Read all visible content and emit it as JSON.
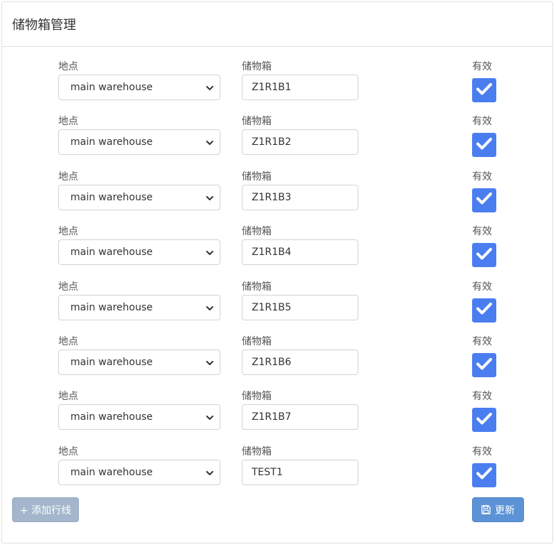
{
  "header": {
    "title": "储物箱管理"
  },
  "labels": {
    "location": "地点",
    "bin": "储物箱",
    "active": "有效"
  },
  "rows": [
    {
      "location": "main warehouse",
      "bin": "Z1R1B1",
      "active": true
    },
    {
      "location": "main warehouse",
      "bin": "Z1R1B2",
      "active": true
    },
    {
      "location": "main warehouse",
      "bin": "Z1R1B3",
      "active": true
    },
    {
      "location": "main warehouse",
      "bin": "Z1R1B4",
      "active": true
    },
    {
      "location": "main warehouse",
      "bin": "Z1R1B5",
      "active": true
    },
    {
      "location": "main warehouse",
      "bin": "Z1R1B6",
      "active": true
    },
    {
      "location": "main warehouse",
      "bin": "Z1R1B7",
      "active": true
    },
    {
      "location": "main warehouse",
      "bin": "TEST1",
      "active": true
    }
  ],
  "footer": {
    "add_label": "+ 添加行线",
    "update_label": "更新"
  },
  "icons": {
    "chevron": "chevron-down-icon",
    "check": "checkmark-icon",
    "save": "floppy-disk-icon"
  },
  "colors": {
    "checkbox": "#4a7ef0",
    "add_button": "#a3b6cc",
    "update_button": "#5c92d6"
  }
}
